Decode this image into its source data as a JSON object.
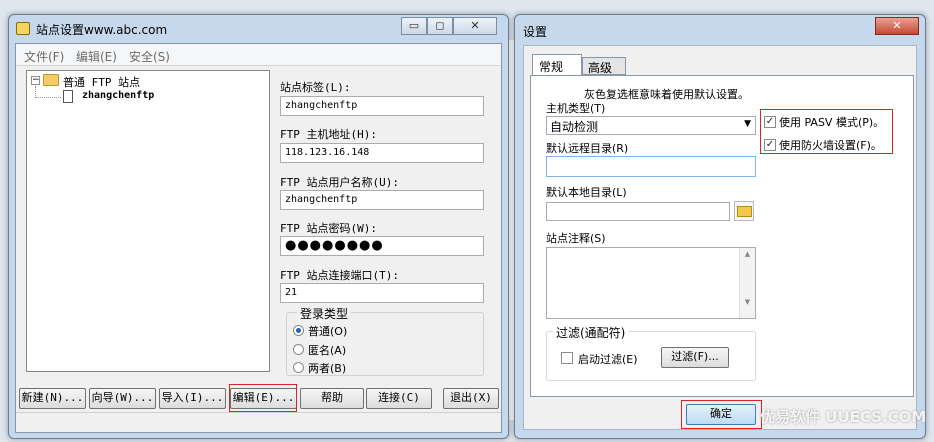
{
  "site_manager": {
    "title": "站点设置www.abc.com",
    "menu": [
      "文件(F)",
      "编辑(E)",
      "安全(S)"
    ],
    "tree": {
      "root": "普通 FTP 站点",
      "child": "zhangchenftp"
    },
    "fields": [
      {
        "label": "站点标签(L):",
        "value": "zhangchenftp"
      },
      {
        "label": "FTP 主机地址(H):",
        "value": "118.123.16.148"
      },
      {
        "label": "FTP 站点用户名称(U):",
        "value": "zhangchenftp"
      },
      {
        "label": "FTP 站点密码(W):",
        "value": "●●●●●●●●"
      },
      {
        "label": "FTP 站点连接端口(T):",
        "value": "21"
      }
    ],
    "login_type": {
      "label": "登录类型",
      "options": [
        "普通(O)",
        "匿名(A)",
        "两者(B)"
      ],
      "selected": 0
    },
    "buttons": [
      "新建(N)...",
      "向导(W)...",
      "导入(I)...",
      "编辑(E)...",
      "帮助",
      "连接(C)",
      "退出(X)"
    ]
  },
  "settings": {
    "title": "设置",
    "tabs": [
      "常规",
      "高级"
    ],
    "note": "灰色复选框意味着使用默认设置。",
    "host_type_label": "主机类型(T)",
    "host_type_value": "自动检测",
    "remote_dir_label": "默认远程目录(R)",
    "local_dir_label": "默认本地目录(L)",
    "notes_label": "站点注释(S)",
    "pasv": "使用 PASV 模式(P)。",
    "firewall": "使用防火墙设置(F)。",
    "filter_label": "过滤(通配符)",
    "filter_enable": "启动过滤(E)",
    "filter_button": "过滤(F)...",
    "ok": "确定"
  },
  "watermark": "优易软件 UUECS.COM"
}
